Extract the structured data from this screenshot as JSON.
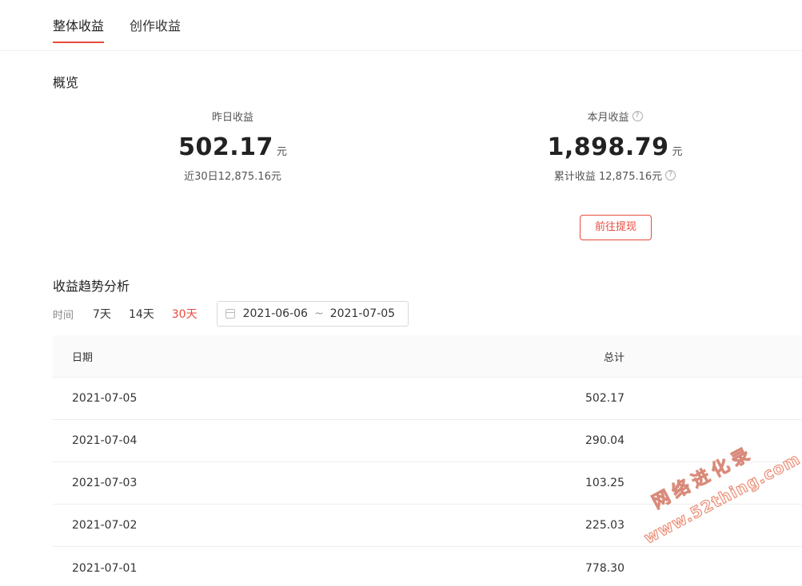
{
  "tabs": [
    {
      "label": "整体收益",
      "active": true
    },
    {
      "label": "创作收益",
      "active": false
    }
  ],
  "overview": {
    "title": "概览",
    "yesterday": {
      "label": "昨日收益",
      "value": "502.17",
      "unit": "元",
      "sub": "近30日12,875.16元"
    },
    "month": {
      "label": "本月收益",
      "value": "1,898.79",
      "unit": "元",
      "sub": "累计收益 12,875.16元"
    },
    "withdraw_label": "前往提现"
  },
  "trend": {
    "title": "收益趋势分析",
    "filter_label": "时间",
    "ranges": [
      "7天",
      "14天",
      "30天"
    ],
    "active_range": "30天",
    "date_start": "2021-06-06",
    "date_sep": "~",
    "date_end": "2021-07-05"
  },
  "table": {
    "headers": {
      "date": "日期",
      "total": "总计"
    },
    "rows": [
      {
        "date": "2021-07-05",
        "total": "502.17"
      },
      {
        "date": "2021-07-04",
        "total": "290.04"
      },
      {
        "date": "2021-07-03",
        "total": "103.25"
      },
      {
        "date": "2021-07-02",
        "total": "225.03"
      },
      {
        "date": "2021-07-01",
        "total": "778.30"
      }
    ]
  },
  "watermark": {
    "cn": "网络进化录",
    "en": "www.52thing.com"
  },
  "colors": {
    "accent": "#e94a3c"
  }
}
